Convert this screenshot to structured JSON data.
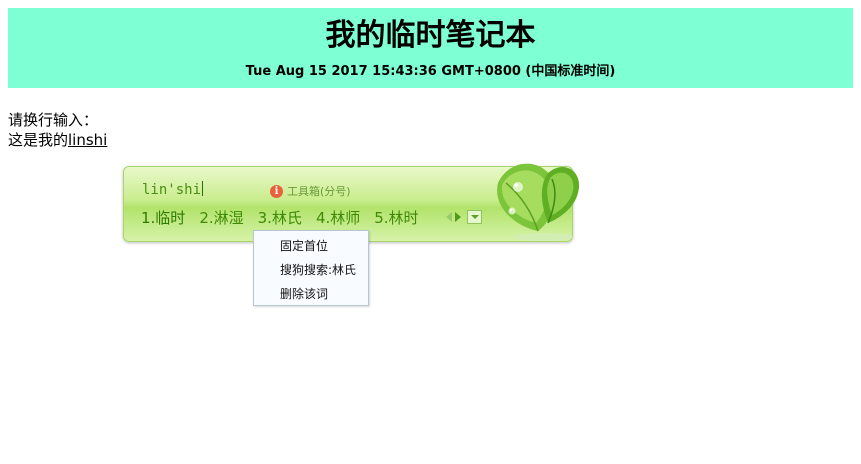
{
  "header": {
    "title": "我的临时笔记本",
    "datetime": "Tue Aug 15 2017 15:43:36 GMT+0800 (中国标准时间)",
    "background": "#7fffd4"
  },
  "editor": {
    "prompt": "请换行输入：",
    "line_prefix": "这是我的",
    "line_typed": "linshi"
  },
  "ime": {
    "pinyin": "lin'shi",
    "toolbox_label": "工具箱(分号)",
    "info_icon": "info-icon",
    "candidates": [
      "1.临时",
      "2.淋湿",
      "3.林氏",
      "4.林师",
      "5.林时"
    ],
    "logo_icon": "leaf-icon",
    "accent": "#b2e36b"
  },
  "context_menu": {
    "items": [
      "固定首位",
      "搜狗搜索:林氏",
      "删除该词"
    ]
  }
}
